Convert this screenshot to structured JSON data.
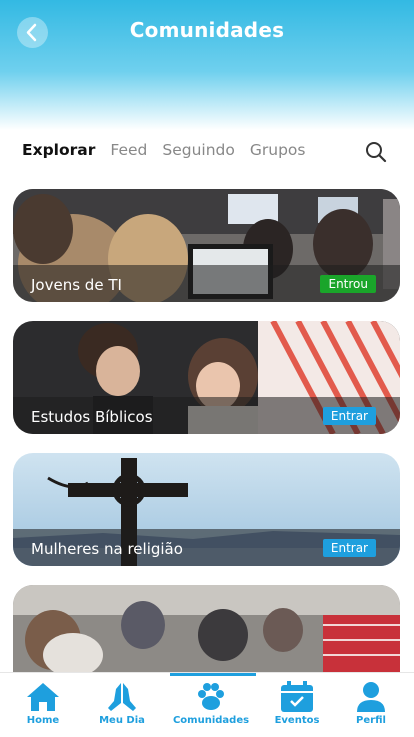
{
  "header": {
    "title": "Comunidades"
  },
  "tabs": [
    {
      "label": "Explorar"
    },
    {
      "label": "Feed"
    },
    {
      "label": "Seguindo"
    },
    {
      "label": "Grupos"
    }
  ],
  "communities": [
    {
      "name": "Jovens de TI",
      "action": "Entrou"
    },
    {
      "name": "Estudos Bíblicos",
      "action": "Entrar"
    },
    {
      "name": "Mulheres na religião",
      "action": "Entrar"
    },
    {
      "name": "",
      "action": ""
    }
  ],
  "bottom_nav": [
    {
      "label": "Home",
      "icon": "home-icon"
    },
    {
      "label": "Meu Dia",
      "icon": "praying-hands-icon"
    },
    {
      "label": "Comunidades",
      "icon": "paw-icon"
    },
    {
      "label": "Eventos",
      "icon": "calendar-check-icon"
    },
    {
      "label": "Perfil",
      "icon": "user-icon"
    }
  ],
  "colors": {
    "accent": "#1e9fde",
    "joined": "#1aa52a",
    "header": "#33b9e3"
  }
}
